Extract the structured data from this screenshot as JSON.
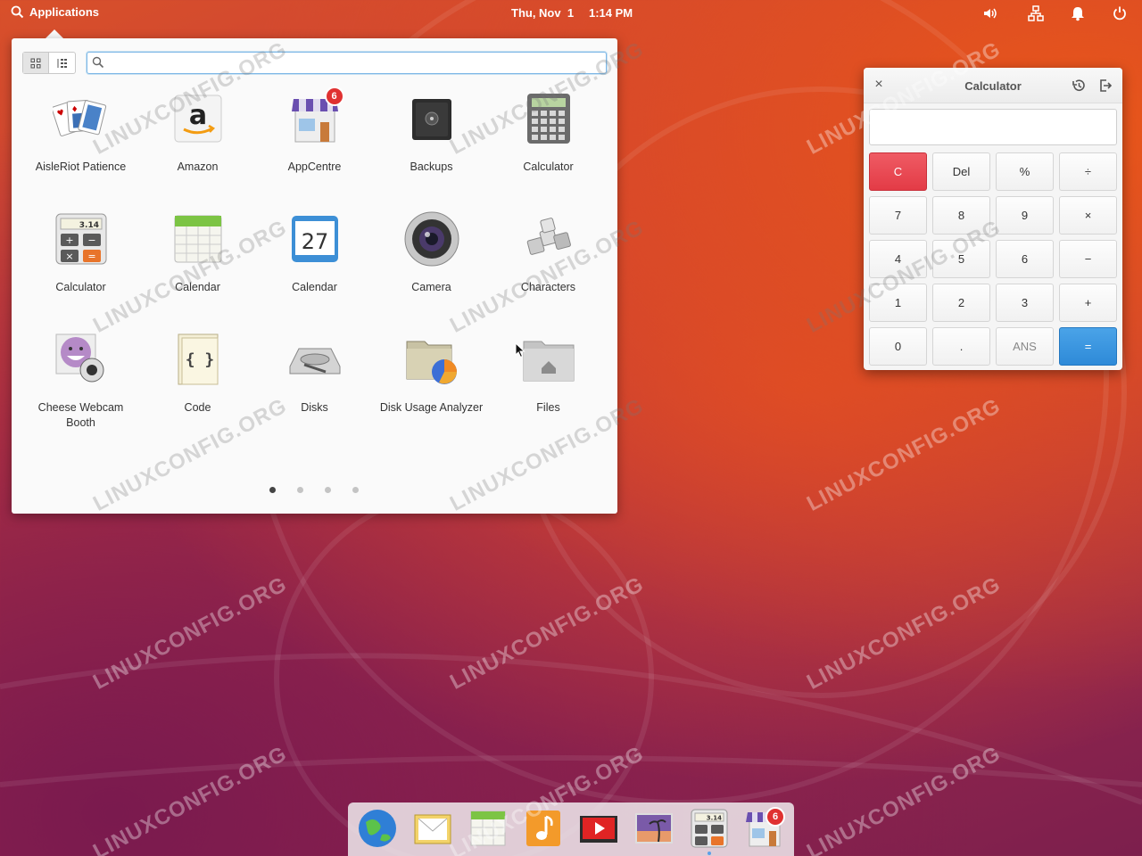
{
  "panel": {
    "applications_label": "Applications",
    "date": "Thu, Nov  1",
    "time": "1:14 PM",
    "indicators": [
      "volume-icon",
      "network-icon",
      "notifications-icon",
      "power-icon"
    ]
  },
  "app_menu": {
    "search_value": "",
    "search_placeholder": "",
    "apps": [
      {
        "label": "AisleRiot Patience",
        "icon": "cards-icon"
      },
      {
        "label": "Amazon",
        "icon": "amazon-icon"
      },
      {
        "label": "AppCentre",
        "icon": "appcentre-icon",
        "badge": "6"
      },
      {
        "label": "Backups",
        "icon": "safe-icon"
      },
      {
        "label": "Calculator",
        "icon": "calculator-icon"
      },
      {
        "label": "Calculator",
        "icon": "calculator-icon"
      },
      {
        "label": "Calendar",
        "icon": "calendar-icon"
      },
      {
        "label": "Calendar",
        "icon": "calendar-27-icon",
        "icon_text": "27"
      },
      {
        "label": "Camera",
        "icon": "camera-icon"
      },
      {
        "label": "Characters",
        "icon": "characters-icon"
      },
      {
        "label": "Cheese Webcam Booth",
        "icon": "cheese-icon"
      },
      {
        "label": "Code",
        "icon": "code-icon",
        "icon_text": "{ }"
      },
      {
        "label": "Disks",
        "icon": "disks-icon"
      },
      {
        "label": "Disk Usage Analyzer",
        "icon": "disk-usage-icon"
      },
      {
        "label": "Files",
        "icon": "files-icon"
      }
    ],
    "pages": 4,
    "active_page": 1
  },
  "calculator": {
    "title": "Calculator",
    "display_value": "",
    "icon_calc_text": "3.14",
    "keys": [
      [
        "C",
        "Del",
        "%",
        "÷"
      ],
      [
        "7",
        "8",
        "9",
        "×"
      ],
      [
        "4",
        "5",
        "6",
        "−"
      ],
      [
        "1",
        "2",
        "3",
        "+"
      ],
      [
        "0",
        ".",
        "ANS",
        "="
      ]
    ]
  },
  "dock": {
    "items": [
      "browser-icon",
      "mail-icon",
      "calendar-icon",
      "music-icon",
      "videos-icon",
      "photos-icon",
      "calculator-icon",
      "appcentre-icon"
    ],
    "appcentre_badge": "6"
  },
  "watermark_text": "LINUXCONFIG.ORG",
  "colors": {
    "clear_key": "#e33b46",
    "equals_key": "#2e8ad8",
    "badge": "#e03131"
  }
}
